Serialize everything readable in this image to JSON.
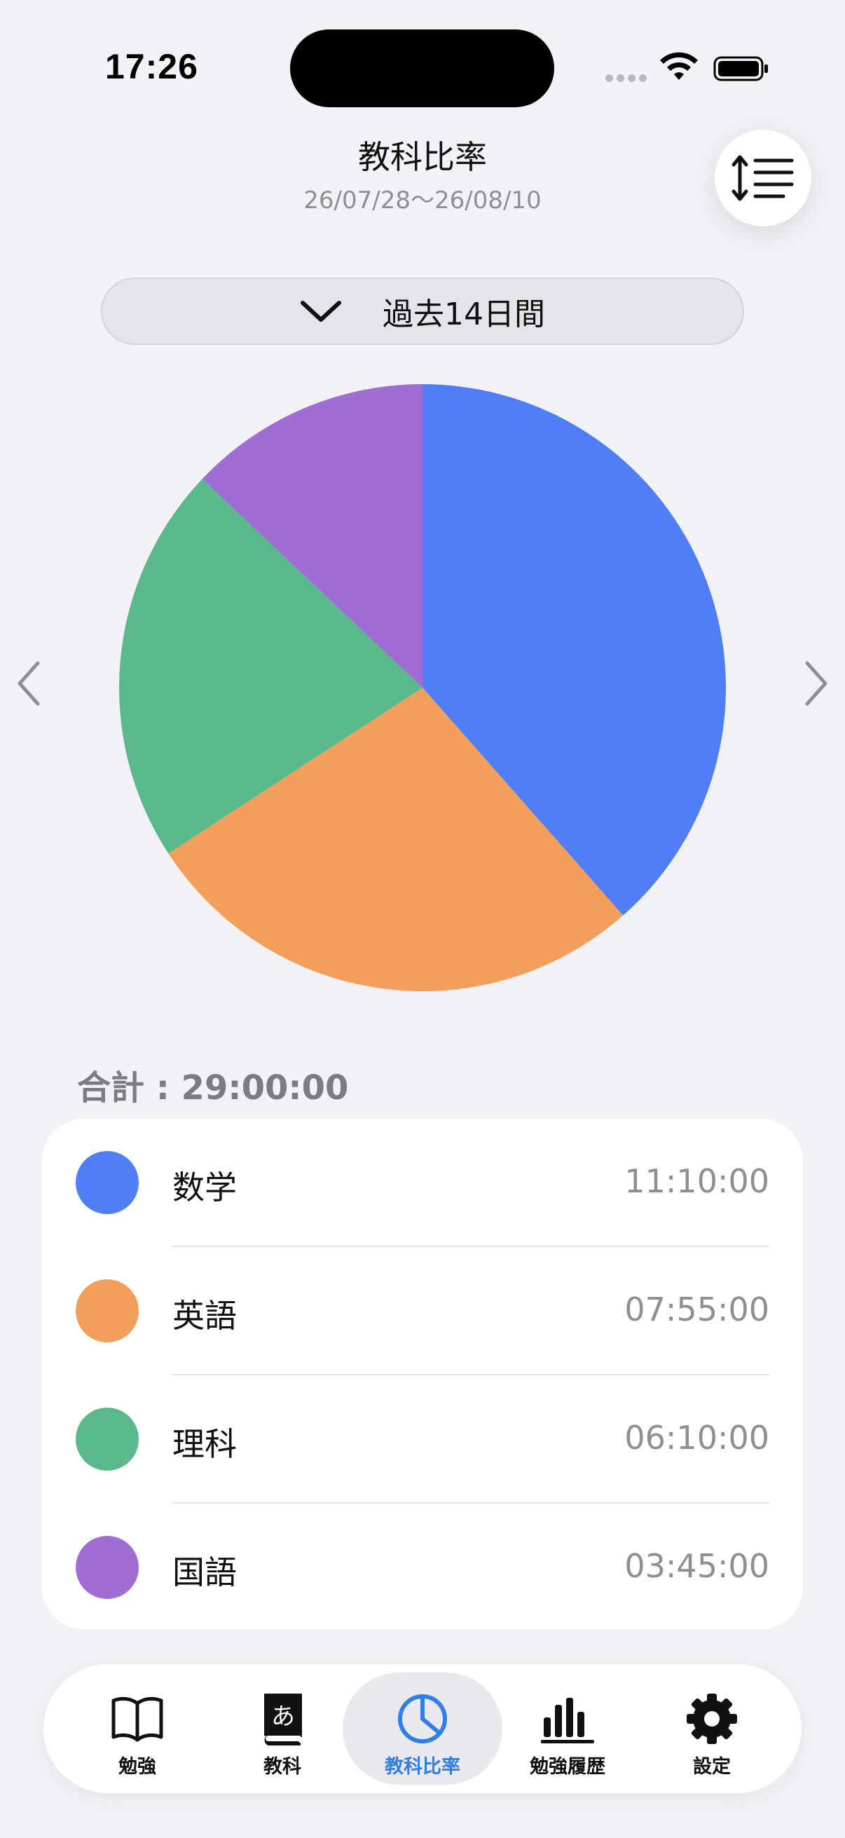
{
  "status_bar": {
    "time": "17:26"
  },
  "header": {
    "title": "教科比率",
    "date_range": "26/07/28～26/08/10"
  },
  "period_selector": {
    "label": "過去14日間"
  },
  "icons": {
    "sort": "sort-lines-icon",
    "chevron": "chevron-down-icon",
    "prev": "chevron-left-icon",
    "next": "chevron-right-icon"
  },
  "chart_data": {
    "type": "pie",
    "slices": [
      {
        "label": "数学",
        "value": 11.1667,
        "color": "#4f7ef7"
      },
      {
        "label": "英語",
        "value": 7.9167,
        "color": "#f39e5a"
      },
      {
        "label": "理科",
        "value": 6.1667,
        "color": "#5ab98a"
      },
      {
        "label": "国語",
        "value": 3.75,
        "color": "#a06dd5"
      }
    ]
  },
  "summary": {
    "total_label": "合計 : 29:00:00"
  },
  "subjects": [
    {
      "name": "数学",
      "time": "11:10:00",
      "color": "#4f7ef7"
    },
    {
      "name": "英語",
      "time": "07:55:00",
      "color": "#f39e5a"
    },
    {
      "name": "理科",
      "time": "06:10:00",
      "color": "#5ab98a"
    },
    {
      "name": "国語",
      "time": "03:45:00",
      "color": "#a06dd5"
    }
  ],
  "tabbar": {
    "items": [
      {
        "label": "勉強",
        "icon": "book-icon"
      },
      {
        "label": "教科",
        "icon": "dictionary-icon"
      },
      {
        "label": "教科比率",
        "icon": "pie-chart-icon",
        "active": true
      },
      {
        "label": "勉強履歴",
        "icon": "bar-chart-icon"
      },
      {
        "label": "設定",
        "icon": "gear-icon"
      }
    ]
  },
  "colors": {
    "accent": "#2f7fe6",
    "background": "#f2f1f6"
  }
}
